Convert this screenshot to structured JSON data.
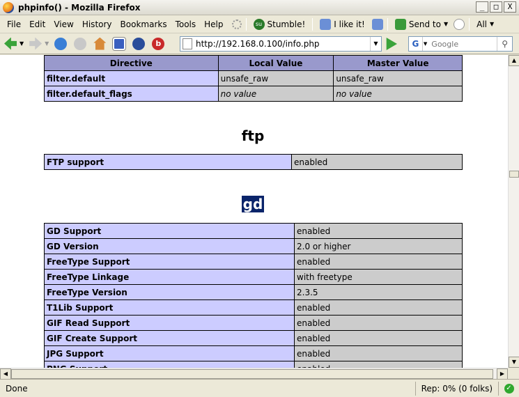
{
  "window": {
    "title": "phpinfo() - Mozilla Firefox",
    "min": "_",
    "max": "□",
    "close": "X"
  },
  "menu": {
    "file": "File",
    "edit": "Edit",
    "view": "View",
    "history": "History",
    "bookmarks": "Bookmarks",
    "tools": "Tools",
    "help": "Help"
  },
  "toolbar": {
    "stumble": "Stumble!",
    "like": "I like it!",
    "send_to": "Send to",
    "all": "All"
  },
  "nav": {
    "url": "http://192.168.0.100/info.php",
    "search_placeholder": "Google",
    "search_engine": "G"
  },
  "sections": {
    "filter": {
      "headers": {
        "directive": "Directive",
        "local": "Local Value",
        "master": "Master Value"
      },
      "rows": [
        {
          "name": "filter.default",
          "local": "unsafe_raw",
          "master": "unsafe_raw"
        },
        {
          "name": "filter.default_flags",
          "local": "no value",
          "master": "no value"
        }
      ]
    },
    "ftp": {
      "title": "ftp",
      "rows": [
        {
          "name": "FTP support",
          "value": "enabled"
        }
      ]
    },
    "gd": {
      "title": "gd",
      "rows": [
        {
          "name": "GD Support",
          "value": "enabled"
        },
        {
          "name": "GD Version",
          "value": "2.0 or higher"
        },
        {
          "name": "FreeType Support",
          "value": "enabled"
        },
        {
          "name": "FreeType Linkage",
          "value": "with freetype"
        },
        {
          "name": "FreeType Version",
          "value": "2.3.5"
        },
        {
          "name": "T1Lib Support",
          "value": "enabled"
        },
        {
          "name": "GIF Read Support",
          "value": "enabled"
        },
        {
          "name": "GIF Create Support",
          "value": "enabled"
        },
        {
          "name": "JPG Support",
          "value": "enabled"
        },
        {
          "name": "PNG Support",
          "value": "enabled"
        }
      ]
    }
  },
  "status": {
    "text": "Done",
    "rep": "Rep: 0% (0 folks)",
    "ok": "✓"
  },
  "icons": {
    "back": "back-arrow-icon",
    "forward": "forward-arrow-icon",
    "reload": "reload-icon",
    "stop": "stop-icon",
    "home": "home-icon"
  }
}
